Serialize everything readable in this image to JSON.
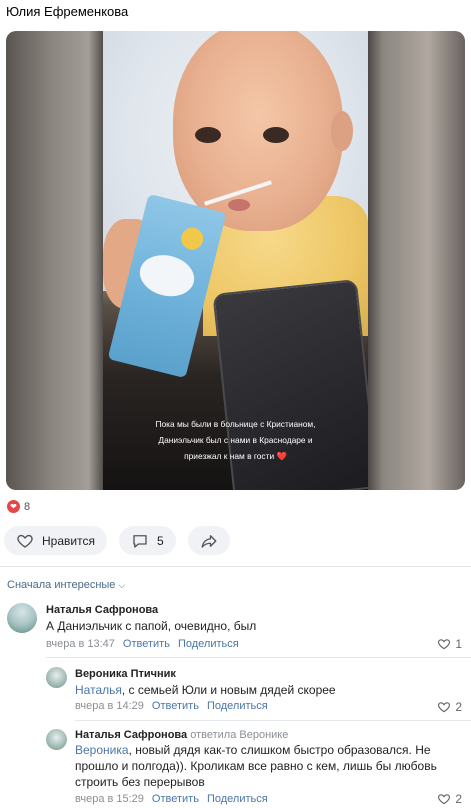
{
  "post": {
    "author": "Юлия Ефременкова",
    "caption_lines": [
      "Пока мы были в больнице с Кристианом,",
      "Даниэльчик был с нами в Краснодаре и",
      "приезжал к нам в гости"
    ],
    "caption_emoji": "❤️",
    "reactions_count": "8",
    "like_label": "Нравится",
    "comments_count": "5"
  },
  "sort_label": "Сначала интересные",
  "comments": [
    {
      "name": "Наталья Сафронова",
      "text": "А Даниэльчик с папой, очевидно, был",
      "time": "вчера в 13:47",
      "reply": "Ответить",
      "share": "Поделиться",
      "likes": "1"
    },
    {
      "name": "Вероника Птичник",
      "mention": "Наталья",
      "text": ", с семьей Юли и новым дядей скорее",
      "time": "вчера в 14:29",
      "reply": "Ответить",
      "share": "Поделиться",
      "likes": "2"
    },
    {
      "name": "Наталья Сафронова",
      "replied_to": "ответила Веронике",
      "mention": "Вероника",
      "text_line1": ", новый дядя как-то слишком быстро образовался. Не",
      "text_line2": "прошло и полгода)). Кроликам все равно с кем, лишь бы любовь",
      "text_line3": "строить без перерывов",
      "time": "вчера в 15:29",
      "reply": "Ответить",
      "share": "Поделиться",
      "likes": "2"
    }
  ],
  "colors": {
    "accent": "#4a76a8",
    "like_red": "#e64646",
    "muted": "#8a8f95"
  }
}
